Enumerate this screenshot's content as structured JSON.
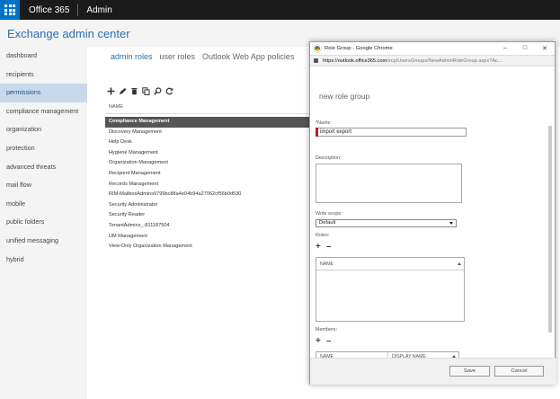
{
  "topbar": {
    "product": "Office 365",
    "section": "Admin"
  },
  "app_title": "Exchange admin center",
  "leftnav": [
    "dashboard",
    "recipients",
    "permissions",
    "compliance management",
    "organization",
    "protection",
    "advanced threats",
    "mail flow",
    "mobile",
    "public folders",
    "unified messaging",
    "hybrid"
  ],
  "leftnav_active_index": 2,
  "tabs": [
    "admin roles",
    "user roles",
    "Outlook Web App policies"
  ],
  "active_tab": 0,
  "list_header": "NAME",
  "role_groups": [
    "Compliance Management",
    "Discovery Management",
    "Help Desk",
    "Hygiene Management",
    "Organization Management",
    "Recipient Management",
    "Records Management",
    "RIM-MailboxAdmins9799bc88a4e04b94a27062cf56b0d530",
    "Security Administrator",
    "Security Reader",
    "TenantAdmins_-811187504",
    "UM Management",
    "View-Only Organization Management"
  ],
  "selected_role_index": 0,
  "popup": {
    "window_title": "Role Group - Google Chrome",
    "url_host": "https://outlook.office365.com",
    "url_path": "/ecp/UsersGroups/NewAdminRoleGroup.aspx?Ac...",
    "heading": "new role group",
    "name_label": "*Name:",
    "name_value": "import export",
    "description_label": "Description:",
    "write_scope_label": "Write scope:",
    "write_scope_value": "Default",
    "roles_label": "Roles:",
    "roles_columns": [
      "NAME"
    ],
    "members_label": "Members:",
    "members_columns": [
      "NAME",
      "DISPLAY NAME"
    ],
    "save_label": "Save",
    "cancel_label": "Cancel"
  },
  "colors": {
    "accent": "#2a6fb0",
    "waffle": "#0072c6",
    "required_marker": "#b01e2f"
  }
}
